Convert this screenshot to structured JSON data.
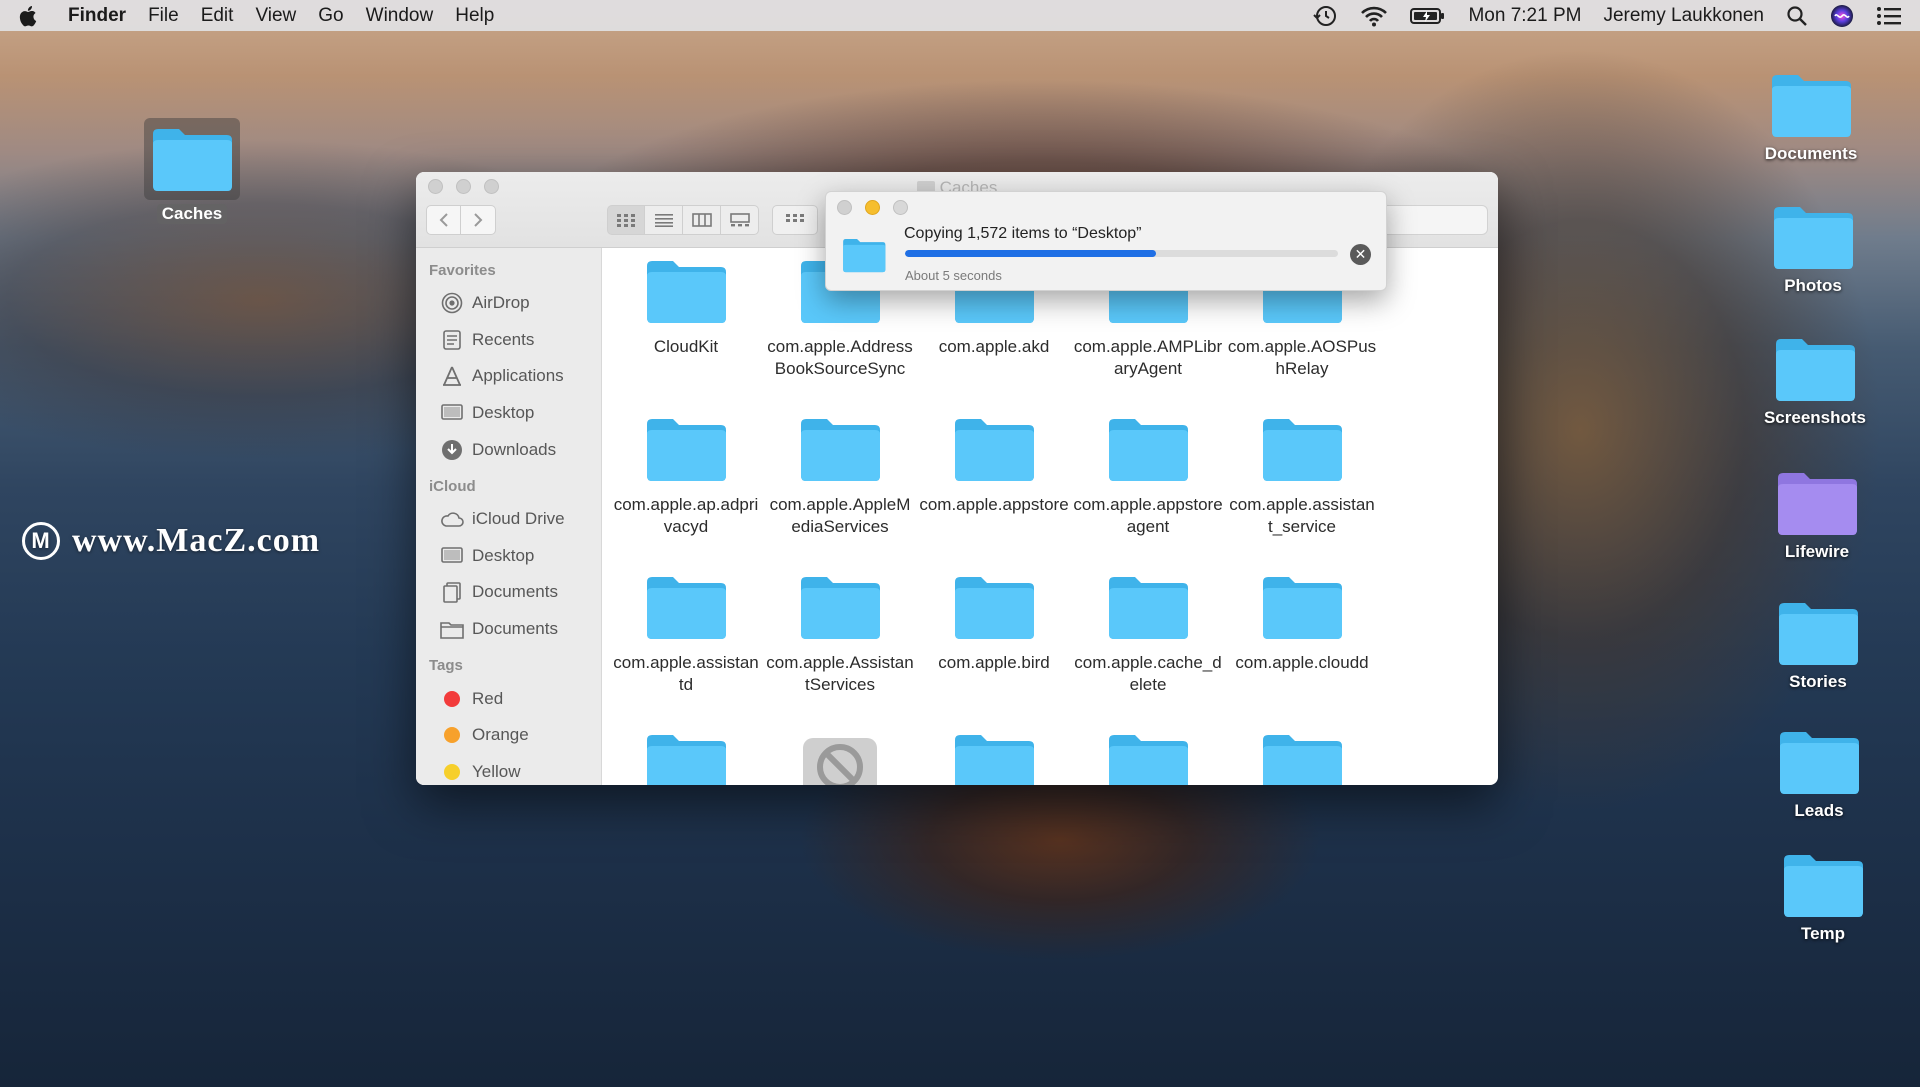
{
  "menubar": {
    "app": "Finder",
    "items": [
      "File",
      "Edit",
      "View",
      "Go",
      "Window",
      "Help"
    ],
    "clock": "Mon 7:21 PM",
    "user": "Jeremy Laukkonen"
  },
  "watermark": {
    "logo": "M",
    "text": "www.MacZ.com"
  },
  "desktop_icons": {
    "caches": "Caches",
    "right": [
      "Documents",
      "Photos",
      "Screenshots",
      "Lifewire",
      "Stories",
      "Leads",
      "Temp"
    ]
  },
  "finder": {
    "title": "Caches",
    "sidebar": {
      "favorites_header": "Favorites",
      "favorites": [
        "AirDrop",
        "Recents",
        "Applications",
        "Desktop",
        "Downloads"
      ],
      "icloud_header": "iCloud",
      "icloud": [
        "iCloud Drive",
        "Desktop",
        "Documents",
        "Documents"
      ],
      "tags_header": "Tags",
      "tags": [
        "Red",
        "Orange",
        "Yellow"
      ]
    },
    "items": [
      "CloudKit",
      "com.apple.AddressBookSourceSync",
      "com.apple.akd",
      "com.apple.AMPLibraryAgent",
      "com.apple.AOSPushRelay",
      "com.apple.ap.adprivacyd",
      "com.apple.AppleMediaServices",
      "com.apple.appstore",
      "com.apple.appstoreagent",
      "com.apple.assistant_service",
      "com.apple.assistantd",
      "com.apple.AssistantServices",
      "com.apple.bird",
      "com.apple.cache_delete",
      "com.apple.cloudd"
    ]
  },
  "copy_dialog": {
    "title": "Copying 1,572 items to “Desktop”",
    "subtitle": "About 5 seconds",
    "progress": 0.58
  },
  "colors": {
    "folder": "#5ac8fa",
    "folder_dark": "#3fb3ea",
    "lifewire_folder": "#a58cf0",
    "progress": "#1f6fe5",
    "tag_red": "#f23b3b",
    "tag_orange": "#f7a12c",
    "tag_yellow": "#f6cf2b"
  }
}
